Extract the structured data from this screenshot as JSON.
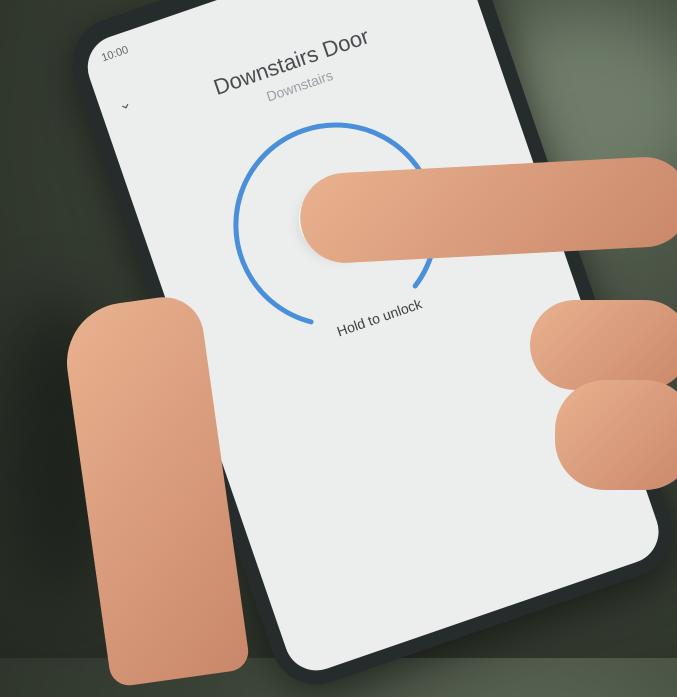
{
  "status_bar": {
    "time": "10:00",
    "icons": "▼◢▮"
  },
  "header": {
    "home_icon": "home-icon",
    "settings_icon": "gear-icon",
    "more_icon": "more-vert-icon",
    "back_icon": "chevron-down-icon"
  },
  "device": {
    "name": "Downstairs Door",
    "room": "Downstairs"
  },
  "lock_control": {
    "label": "Hold to unlock",
    "accent_color": "#4a8fd9"
  }
}
